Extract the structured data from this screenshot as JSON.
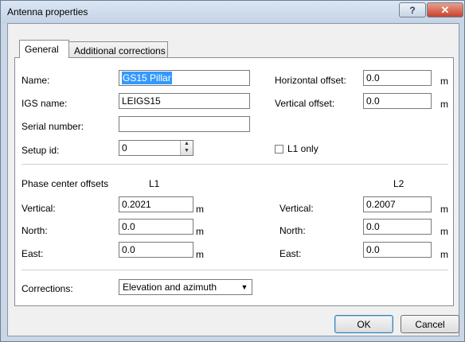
{
  "window": {
    "title": "Antenna properties"
  },
  "titlebar_buttons": {
    "help": "?",
    "close": "✕"
  },
  "tabs": [
    {
      "label": "General",
      "active": true
    },
    {
      "label": "Additional corrections",
      "active": false
    }
  ],
  "general": {
    "name_label": "Name:",
    "name_value": "GS15 Pillar",
    "igs_label": "IGS name:",
    "igs_value": "LEIGS15",
    "serial_label": "Serial number:",
    "serial_value": "",
    "setup_label": "Setup id:",
    "setup_value": "0",
    "hoff_label": "Horizontal offset:",
    "hoff_value": "0.0",
    "voff_label": "Vertical offset:",
    "voff_value": "0.0",
    "unit_m": "m",
    "l1only_label": "L1 only",
    "l1only_checked": false
  },
  "phase": {
    "header": "Phase center offsets",
    "l1_header": "L1",
    "l2_header": "L2",
    "vertical_label": "Vertical:",
    "north_label": "North:",
    "east_label": "East:",
    "l1": {
      "vertical": "0.2021",
      "north": "0.0",
      "east": "0.0"
    },
    "l2": {
      "vertical": "0.2007",
      "north": "0.0",
      "east": "0.0"
    }
  },
  "corrections": {
    "label": "Corrections:",
    "value": "Elevation and azimuth"
  },
  "buttons": {
    "ok": "OK",
    "cancel": "Cancel"
  }
}
